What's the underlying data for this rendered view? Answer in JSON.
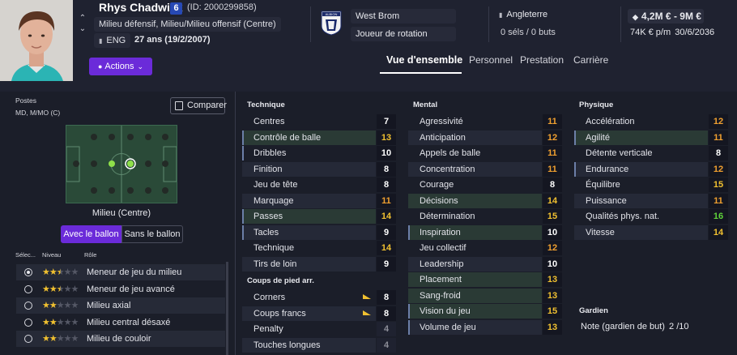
{
  "player": {
    "name": "Rhys Chadwick",
    "shirt_number": "6",
    "id_text": "(ID: 2000299858)",
    "positions_text": "Milieu défensif, Milieu/Milieu offensif (Centre)",
    "nation": "ENG",
    "age_text": "27 ans (19/2/2007)"
  },
  "actions_label": "Actions",
  "club": {
    "name": "West Brom",
    "role": "Joueur de rotation",
    "crest_text": "ALBION"
  },
  "international": {
    "country": "Angleterre",
    "caps": "0 séls / 0 buts"
  },
  "contract": {
    "value": "4,2M € - 9M €",
    "wage": "74K € p/m",
    "expiry": "30/6/2036"
  },
  "tabs": [
    "Vue d'ensemble",
    "Personnel",
    "Prestation",
    "Carrière"
  ],
  "active_tab": 0,
  "left": {
    "postes_label": "Postes",
    "postes_value": "MD, M/MO (C)",
    "compare_label": "Comparer",
    "pitch_caption": "Milieu (Centre)",
    "ball_on": "Avec le ballon",
    "ball_off": "Sans le ballon",
    "role_headers": {
      "select": "Sélec...",
      "level": "Niveau",
      "role": "Rôle"
    },
    "roles": [
      {
        "name": "Meneur de jeu du milieu",
        "stars": 2.5,
        "selected": true
      },
      {
        "name": "Meneur de jeu avancé",
        "stars": 2.5,
        "selected": false
      },
      {
        "name": "Milieu axial",
        "stars": 2,
        "selected": false
      },
      {
        "name": "Milieu central désaxé",
        "stars": 2,
        "selected": false
      },
      {
        "name": "Milieu de couloir",
        "stars": 2,
        "selected": false
      }
    ]
  },
  "technique": {
    "title": "Technique",
    "attrs": [
      {
        "name": "Centres",
        "value": 7
      },
      {
        "name": "Contrôle de balle",
        "value": 13
      },
      {
        "name": "Dribbles",
        "value": 10
      },
      {
        "name": "Finition",
        "value": 8
      },
      {
        "name": "Jeu de tête",
        "value": 8
      },
      {
        "name": "Marquage",
        "value": 11
      },
      {
        "name": "Passes",
        "value": 14
      },
      {
        "name": "Tacles",
        "value": 9
      },
      {
        "name": "Technique",
        "value": 14
      },
      {
        "name": "Tirs de loin",
        "value": 9
      }
    ]
  },
  "set_pieces": {
    "title": "Coups de pied arr.",
    "attrs": [
      {
        "name": "Corners",
        "value": 8
      },
      {
        "name": "Coups francs",
        "value": 8
      },
      {
        "name": "Penalty",
        "value": 4
      },
      {
        "name": "Touches longues",
        "value": 4
      }
    ]
  },
  "mental": {
    "title": "Mental",
    "attrs": [
      {
        "name": "Agressivité",
        "value": 11
      },
      {
        "name": "Anticipation",
        "value": 12
      },
      {
        "name": "Appels de balle",
        "value": 11
      },
      {
        "name": "Concentration",
        "value": 11
      },
      {
        "name": "Courage",
        "value": 8
      },
      {
        "name": "Décisions",
        "value": 14
      },
      {
        "name": "Détermination",
        "value": 15
      },
      {
        "name": "Inspiration",
        "value": 10
      },
      {
        "name": "Jeu collectif",
        "value": 12
      },
      {
        "name": "Leadership",
        "value": 10
      },
      {
        "name": "Placement",
        "value": 13
      },
      {
        "name": "Sang-froid",
        "value": 13
      },
      {
        "name": "Vision du jeu",
        "value": 15
      },
      {
        "name": "Volume de jeu",
        "value": 13
      }
    ]
  },
  "physique": {
    "title": "Physique",
    "attrs": [
      {
        "name": "Accélération",
        "value": 12
      },
      {
        "name": "Agilité",
        "value": 11
      },
      {
        "name": "Détente verticale",
        "value": 8
      },
      {
        "name": "Endurance",
        "value": 12
      },
      {
        "name": "Équilibre",
        "value": 15
      },
      {
        "name": "Puissance",
        "value": 11
      },
      {
        "name": "Qualités phys. nat.",
        "value": 16
      },
      {
        "name": "Vitesse",
        "value": 14
      }
    ]
  },
  "goalkeeper": {
    "title": "Gardien",
    "label": "Note (gardien de but)",
    "value": "2 /10"
  },
  "colors": {
    "accent": "#6b2bd9",
    "shirt": "#2749b5",
    "value_yellow": "#f0c030",
    "value_green": "#5fd33a"
  }
}
